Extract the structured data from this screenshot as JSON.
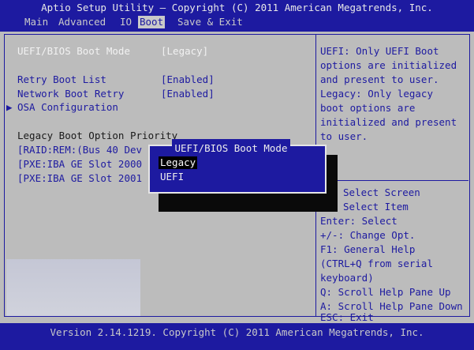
{
  "header": {
    "title": "Aptio Setup Utility – Copyright (C) 2011 American Megatrends, Inc.",
    "tabs": [
      "Main",
      "Advanced",
      "IO",
      "Boot",
      "Save & Exit"
    ],
    "active_tab": "Boot"
  },
  "main": {
    "boot_mode_label": "UEFI/BIOS Boot Mode",
    "boot_mode_value": "[Legacy]",
    "retry_label": "Retry Boot List",
    "retry_value": "[Enabled]",
    "network_label": "Network Boot Retry",
    "network_value": "[Enabled]",
    "osa_label": "OSA Configuration",
    "priority_heading": "Legacy Boot Option Priority",
    "priority_items": [
      "[RAID:REM:(Bus 40 Dev",
      "[PXE:IBA GE Slot 2000",
      "[PXE:IBA GE Slot 2001"
    ]
  },
  "help": {
    "lines": [
      "UEFI: Only UEFI Boot",
      "options are initialized",
      "and present to user.",
      "Legacy: Only legacy",
      "boot options are",
      "initialized and present",
      "to user."
    ],
    "keys": [
      "Select Screen",
      "Select Item",
      "Enter: Select",
      "+/-: Change Opt.",
      "F1: General Help",
      "(CTRL+Q from serial",
      "keyboard)",
      "Q: Scroll Help Pane Up",
      "A: Scroll Help Pane Down",
      "ESC: Exit"
    ]
  },
  "popup": {
    "title": "UEFI/BIOS Boot Mode",
    "options": [
      "Legacy",
      "UEFI"
    ],
    "selected": "Legacy"
  },
  "footer": {
    "version": "Version 2.14.1219. Copyright (C) 2011 American Megatrends, Inc."
  },
  "colors": {
    "bios_blue": "#1d1aa0",
    "background_gray": "#bcbcbc"
  }
}
